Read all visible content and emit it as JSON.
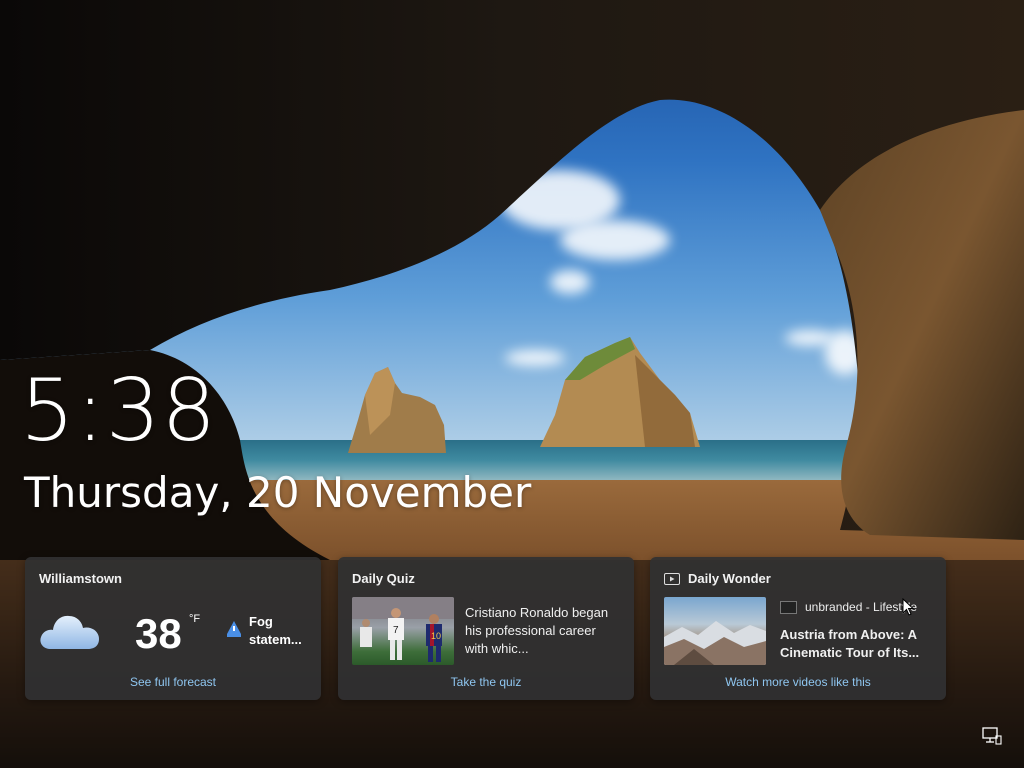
{
  "lock_screen": {
    "time": "5:38",
    "date": "Thursday, 20 November"
  },
  "widgets": {
    "weather": {
      "location": "Williamstown",
      "temperature": "38",
      "unit": "°F",
      "condition_line1": "Fog",
      "condition_line2": "statem...",
      "icon": "cloud-icon",
      "link": "See full forecast"
    },
    "quiz": {
      "title": "Daily Quiz",
      "text_line1": "Cristiano Ronaldo began",
      "text_line2": "his professional career",
      "text_line3": "with whic...",
      "link": "Take the quiz"
    },
    "wonder": {
      "title": "Daily Wonder",
      "source": "unbranded - Lifestyle",
      "headline_line1": "Austria from Above: A",
      "headline_line2": "Cinematic Tour of Its...",
      "link": "Watch more videos like this"
    }
  },
  "system_tray": {
    "icon": "network-icon"
  },
  "colors": {
    "card_bg": "#303032",
    "link": "#8fc6f0",
    "sky": "#2f73c2"
  }
}
